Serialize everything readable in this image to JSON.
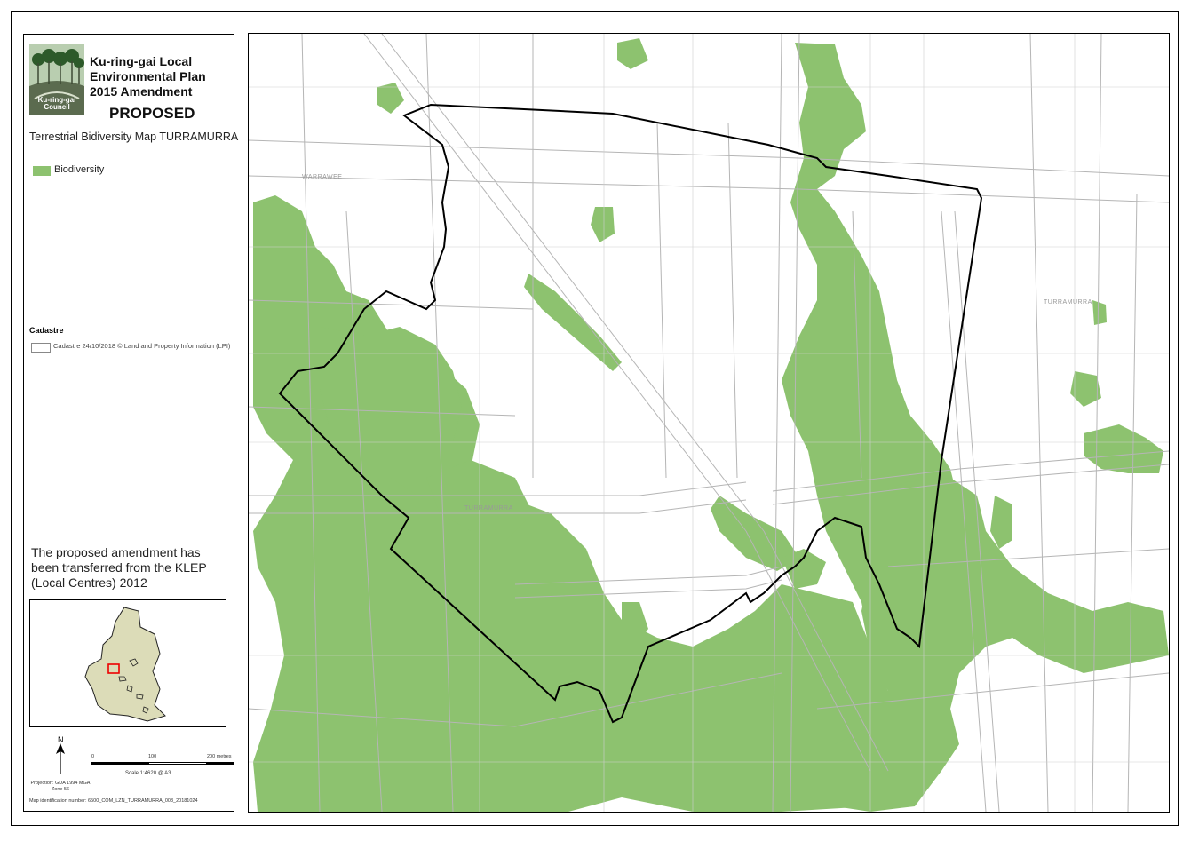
{
  "panel": {
    "logo_text": "Ku-ring-gai\nCouncil",
    "title": "Ku-ring-gai Local Environmental Plan 2015 Amendment",
    "status": "PROPOSED",
    "map_title": "Terrestrial Bidiversity Map TURRAMURRA",
    "legend": {
      "biodiversity_label": "Biodiversity",
      "biodiversity_color": "#8dc26f",
      "cadastre_heading": "Cadastre",
      "cadastre_label": "Cadastre 24/10/2018 © Land and Property Information (LPI)"
    },
    "note": "The proposed amendment has been transferred from the KLEP (Local Centres) 2012",
    "north_label": "N",
    "projection": "Projection: GDA 1994 MGA Zone 56",
    "scale": {
      "ticks": [
        "0",
        "100",
        "200 metres"
      ],
      "label": "Scale   1:4620   @ A3"
    },
    "map_id": "Map identification number:   6500_COM_LZN_TURRAMURRA_003_20181024"
  },
  "map": {
    "labels": {
      "warrawee": "WARRAWEE",
      "turramurra_center": "TURRAMURRA",
      "turramurra_east": "TURRAMURRA"
    },
    "colors": {
      "vegetation": "#8dc26f",
      "streets": "#b5b5b5",
      "boundary": "#000000"
    }
  }
}
